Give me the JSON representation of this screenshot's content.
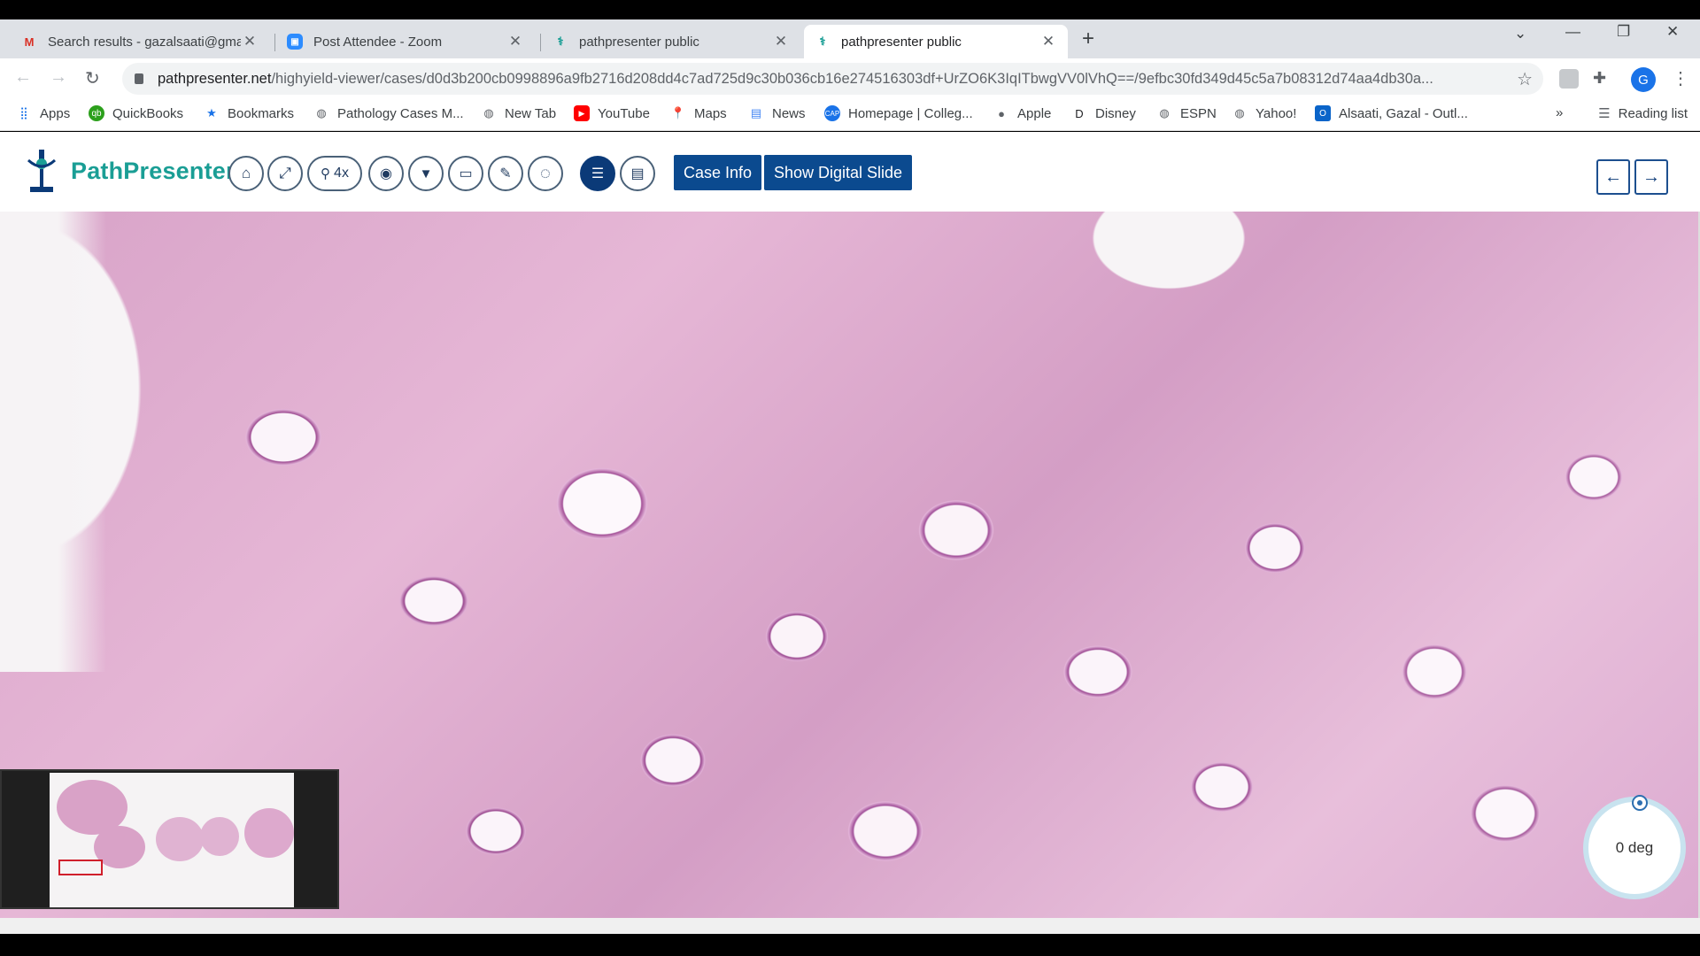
{
  "browser": {
    "tabs": [
      {
        "title": "Search results - gazalsaati@gmail.com",
        "icon": "gmail-icon",
        "active": false
      },
      {
        "title": "Post Attendee - Zoom",
        "icon": "zoom-icon",
        "active": false
      },
      {
        "title": "pathpresenter public",
        "icon": "pathpresenter-icon",
        "active": false
      },
      {
        "title": "pathpresenter public",
        "icon": "pathpresenter-icon",
        "active": true
      }
    ],
    "url_host": "pathpresenter.net",
    "url_path": "/highyield-viewer/cases/d0d3b200cb0998896a9fb2716d208dd4c7ad725d9c30b036cb16e274516303df+UrZO6K3IqITbwgVV0lVhQ==/9efbc30fd349d45c5a7b08312d74aa4db30a...",
    "profile_initial": "G",
    "bookmarks": [
      {
        "label": "Apps",
        "icon": "apps-grid-icon"
      },
      {
        "label": "QuickBooks",
        "icon": "quickbooks-icon"
      },
      {
        "label": "Bookmarks",
        "icon": "star-icon"
      },
      {
        "label": "Pathology Cases M...",
        "icon": "globe-icon"
      },
      {
        "label": "New Tab",
        "icon": "globe-icon"
      },
      {
        "label": "YouTube",
        "icon": "youtube-icon"
      },
      {
        "label": "Maps",
        "icon": "maps-pin-icon"
      },
      {
        "label": "News",
        "icon": "news-icon"
      },
      {
        "label": "Homepage | Colleg...",
        "icon": "cap-icon"
      },
      {
        "label": "Apple",
        "icon": "apple-icon"
      },
      {
        "label": "Disney",
        "icon": "disney-icon"
      },
      {
        "label": "ESPN",
        "icon": "globe-icon"
      },
      {
        "label": "Yahoo!",
        "icon": "globe-icon"
      },
      {
        "label": "Alsaati, Gazal - Outl...",
        "icon": "outlook-icon"
      }
    ],
    "reading_list": "Reading list"
  },
  "app": {
    "brand": "PathPresenter",
    "zoom_label": "4x",
    "case_info_label": "Case Info",
    "show_slide_label": "Show Digital Slide",
    "rotation_label": "0 deg",
    "colors": {
      "brand": "#1a9e95",
      "primary_button": "#0b4a8f",
      "roi": "#d01f2b"
    }
  }
}
